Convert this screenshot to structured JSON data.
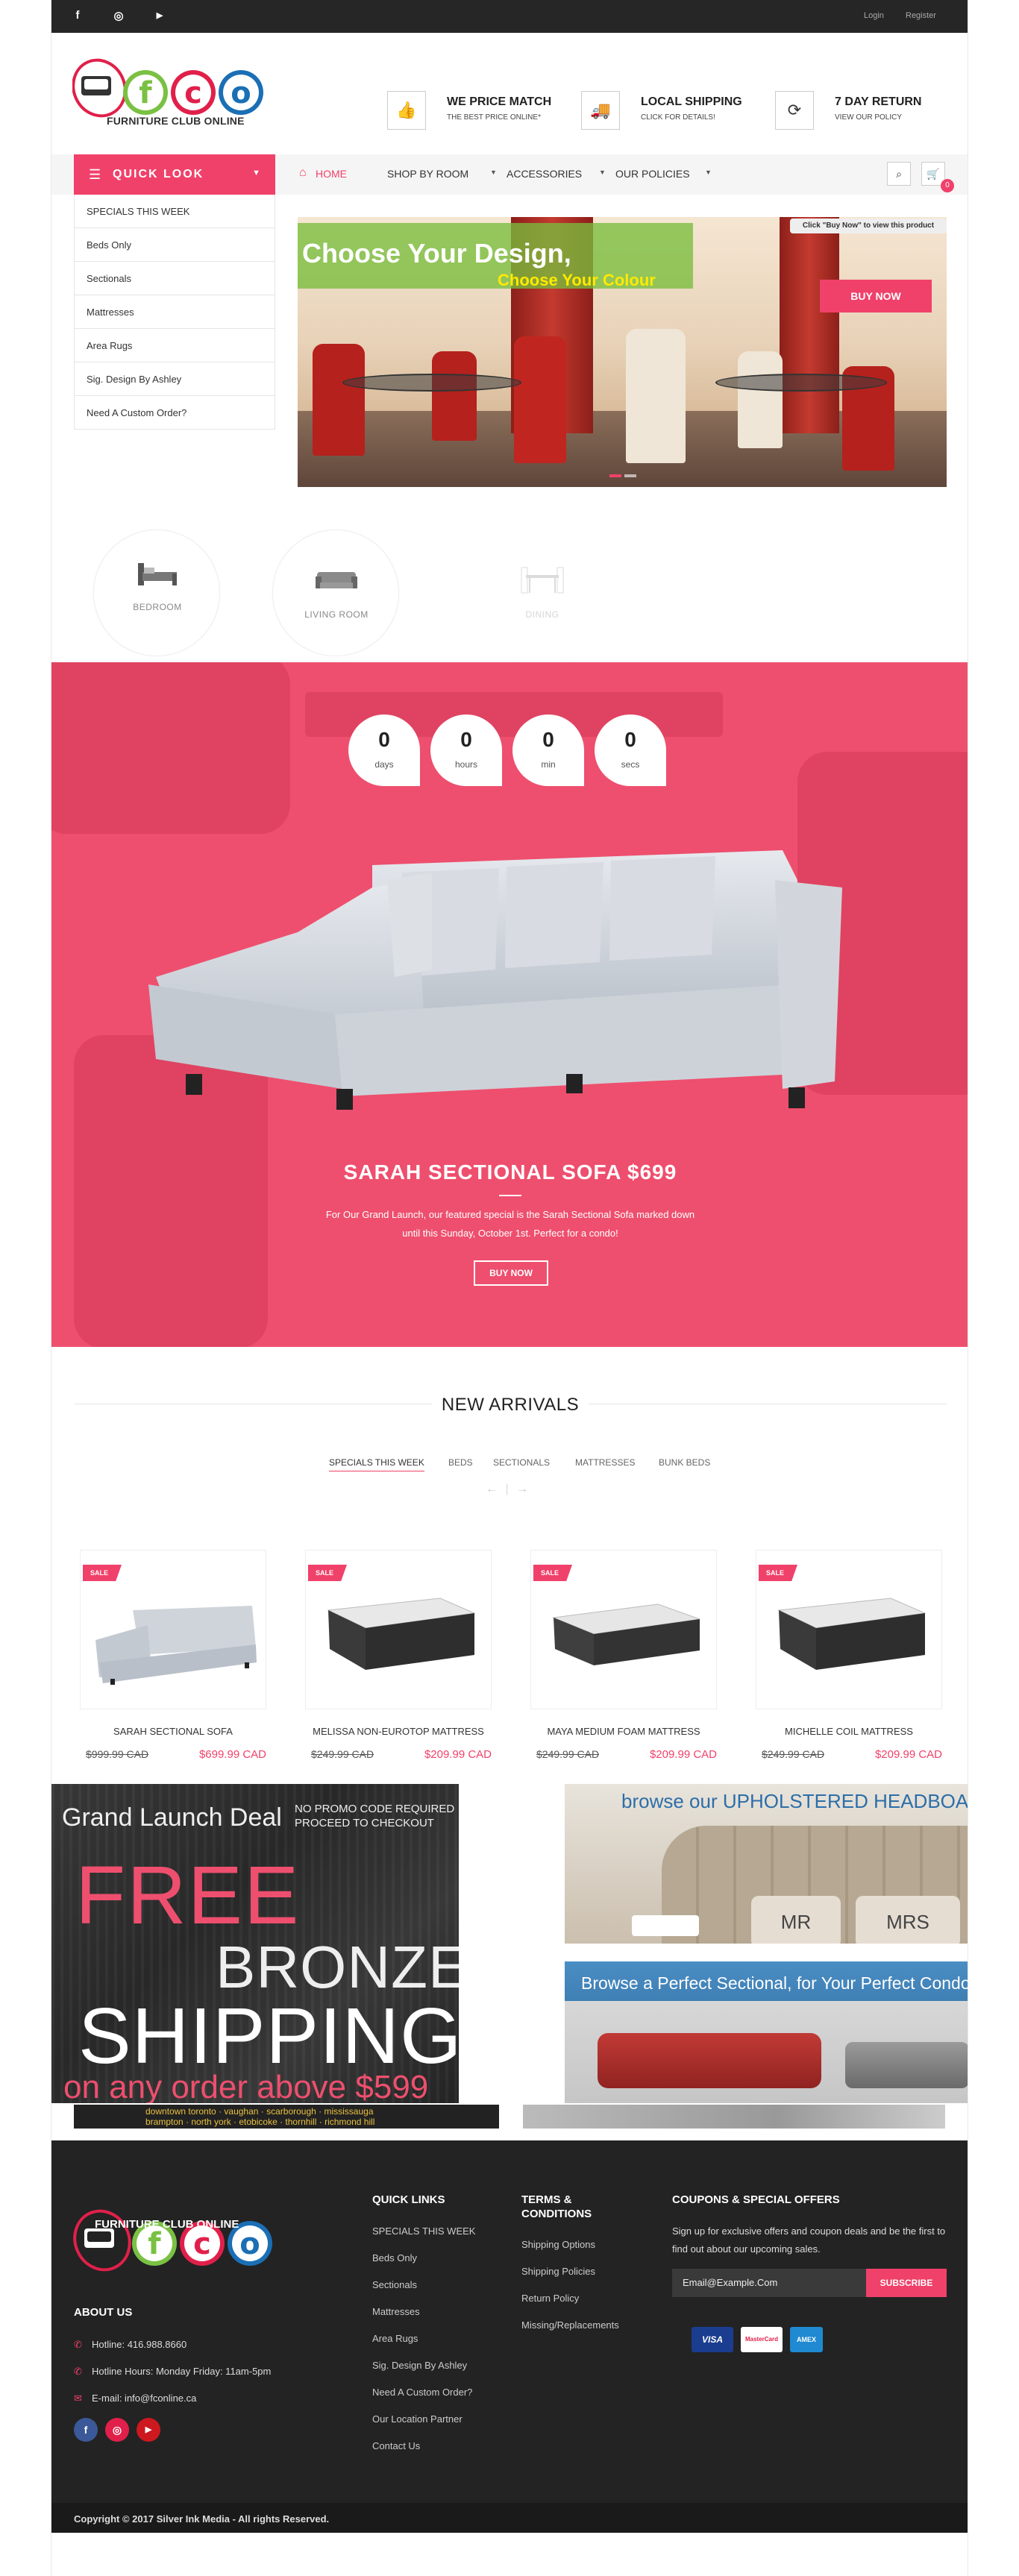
{
  "topbar": {
    "social": [
      "f",
      "◎",
      "▶"
    ],
    "login": "Login",
    "register": "Register"
  },
  "brand": {
    "name": "FURNITURE CLUB ONLINE",
    "letters": [
      "f",
      "c",
      "o"
    ],
    "colors": {
      "accent": "#f0416a",
      "green": "#7ac143",
      "red": "#e0204a",
      "blue": "#1a6fb5",
      "dark": "#232323"
    }
  },
  "features": [
    {
      "title": "WE PRICE MATCH",
      "sub": "THE BEST PRICE ONLINE*",
      "icon": "thumbs-up-icon"
    },
    {
      "title": "LOCAL SHIPPING",
      "sub": "CLICK FOR DETAILS!",
      "icon": "truck-icon"
    },
    {
      "title": "7 DAY RETURN",
      "sub": "VIEW OUR POLICY",
      "icon": "refresh-icon"
    }
  ],
  "nav": {
    "quick_look": "QUICK LOOK",
    "home": "HOME",
    "items": [
      "SHOP BY ROOM",
      "ACCESSORIES",
      "OUR POLICIES"
    ],
    "cart_count": "0"
  },
  "quick_list": [
    "SPECIALS THIS WEEK",
    "Beds Only",
    "Sectionals",
    "Mattresses",
    "Area Rugs",
    "Sig. Design By Ashley",
    "Need A Custom Order?"
  ],
  "slider": {
    "heading": "Choose Your Design,",
    "subheading": "Choose Your Colour",
    "note": "Click \"Buy Now\" to view this product",
    "button": "BUY NOW"
  },
  "categories": [
    "BEDROOM",
    "LIVING ROOM",
    "DINING"
  ],
  "promo": {
    "timer": [
      {
        "value": "0",
        "label": "days"
      },
      {
        "value": "0",
        "label": "hours"
      },
      {
        "value": "0",
        "label": "min"
      },
      {
        "value": "0",
        "label": "secs"
      }
    ],
    "title": "SARAH SECTIONAL SOFA $699",
    "desc_line1": "For Our Grand Launch, our featured special is the Sarah Sectional Sofa marked down",
    "desc_line2": "until this Sunday, October 1st. Perfect for a condo!",
    "button": "BUY NOW"
  },
  "new_arrivals": {
    "title": "NEW ARRIVALS",
    "tabs": [
      "SPECIALS THIS WEEK",
      "BEDS",
      "SECTIONALS",
      "MATTRESSES",
      "BUNK BEDS"
    ],
    "prev": "←",
    "next": "→",
    "products": [
      {
        "sale": "SALE",
        "name": "SARAH SECTIONAL SOFA",
        "old_price": "$999.99 CAD",
        "new_price": "$699.99 CAD"
      },
      {
        "sale": "SALE",
        "name": "MELISSA NON-EUROTOP MATTRESS",
        "old_price": "$249.99 CAD",
        "new_price": "$209.99 CAD"
      },
      {
        "sale": "SALE",
        "name": "MAYA MEDIUM FOAM MATTRESS",
        "old_price": "$249.99 CAD",
        "new_price": "$209.99 CAD"
      },
      {
        "sale": "SALE",
        "name": "MICHELLE COIL MATTRESS",
        "old_price": "$249.99 CAD",
        "new_price": "$209.99 CAD"
      }
    ]
  },
  "banners": {
    "free": {
      "line1": "Grand Launch Deal",
      "line2a": "NO PROMO CODE REQUIRED",
      "line2b": "PROCEED TO CHECKOUT",
      "free": "FREE",
      "bronze": "BRONZE",
      "shipping": "SHIPPING",
      "condition": "on any order above $599",
      "cities1": "downtown toronto · vaughan · scarborough · mississauga",
      "cities2": "brampton · north york · etobicoke · thornhill · richmond hill"
    },
    "headboards": {
      "text": "browse our UPHOLSTERED HEADBOARDS",
      "p1": "MR",
      "p2": "MRS"
    },
    "sectional": {
      "text": "Browse a Perfect Sectional, for Your Perfect Condo"
    }
  },
  "footer": {
    "about": "ABOUT US",
    "hotline": "Hotline: 416.988.8660",
    "hours": "Hotline Hours: Monday Friday: 11am-5pm",
    "email": "E-mail: info@fconline.ca",
    "quick_links_title": "QUICK LINKS",
    "quick_links": [
      "SPECIALS THIS WEEK",
      "Beds Only",
      "Sectionals",
      "Mattresses",
      "Area Rugs",
      "Sig. Design By Ashley",
      "Need A Custom Order?",
      "Our Location Partner",
      "Contact Us"
    ],
    "terms_title_1": "TERMS &",
    "terms_title_2": "CONDITIONS",
    "terms": [
      "Shipping Options",
      "Shipping Policies",
      "Return Policy",
      "Missing/Replacements"
    ],
    "coupons_title": "COUPONS & SPECIAL OFFERS",
    "coupons_desc": "Sign up for exclusive offers and coupon deals and be the first to find out about our upcoming sales.",
    "email_placeholder": "Email@Example.Com",
    "subscribe": "SUBSCRIBE",
    "cards": [
      "VISA",
      "MasterCard",
      "AMEX"
    ],
    "copyright": "Copyright © 2017 Silver Ink Media - All rights Reserved."
  }
}
